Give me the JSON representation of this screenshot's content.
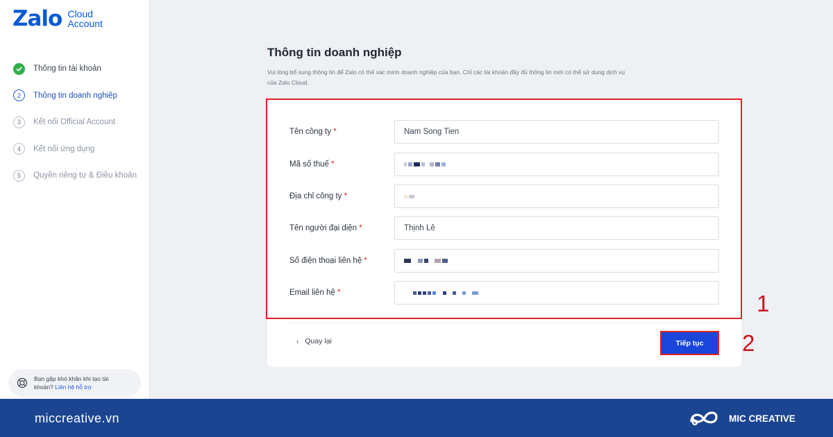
{
  "logo": {
    "brand": "Zalo",
    "sub_line1": "Cloud",
    "sub_line2": "Account",
    "color": "#0a5ad8"
  },
  "sidebar": {
    "steps": [
      {
        "num": "✓",
        "label": "Thông tin tài khoản",
        "state": "done"
      },
      {
        "num": "2",
        "label": "Thông tin doanh nghiệp",
        "state": "active"
      },
      {
        "num": "3",
        "label": "Kết nối Official Account",
        "state": "pending"
      },
      {
        "num": "4",
        "label": "Kết nối ứng dụng",
        "state": "pending"
      },
      {
        "num": "5",
        "label": "Quyền riêng tư & Điều khoản",
        "state": "pending"
      }
    ],
    "help": {
      "text_line1": "Bạn gặp khó khăn khi tạo tài",
      "text_line2": "khoản?",
      "link": "Liên hệ hỗ trợ"
    }
  },
  "main": {
    "title": "Thông tin doanh nghiệp",
    "description_line1": "Vui lòng bổ sung thông tin để Zalo có thể xác minh doanh nghiệp của bạn. Chỉ các tài khoản đầy đủ thông tin mới có thể sử dụng dịch vụ",
    "description_line2": "của Zalo Cloud."
  },
  "form": {
    "fields": [
      {
        "label": "Tên công ty",
        "required": "*",
        "value": "Nam Song Tien"
      },
      {
        "label": "Mã số thuế",
        "required": "*",
        "value": ""
      },
      {
        "label": "Địa chỉ công ty",
        "required": "*",
        "value": ""
      },
      {
        "label": "Tên người đại diện",
        "required": "*",
        "value": "Thịnh Lê"
      },
      {
        "label": "Số điện thoại liên hệ",
        "required": "*",
        "value": ""
      },
      {
        "label": "Email liên hệ",
        "required": "*",
        "value": ""
      }
    ],
    "back_label": "Quay lại",
    "next_label": "Tiếp tục"
  },
  "annotations": {
    "marker_1": "1",
    "marker_2": "2",
    "color": "#e41e26"
  },
  "footer": {
    "site": "miccreative.vn",
    "brand": "MIC CREATIVE",
    "bg_color": "#1b4591"
  },
  "colors": {
    "primary": "#1a45d9",
    "success": "#2fb14b",
    "required": "#e41e26"
  }
}
